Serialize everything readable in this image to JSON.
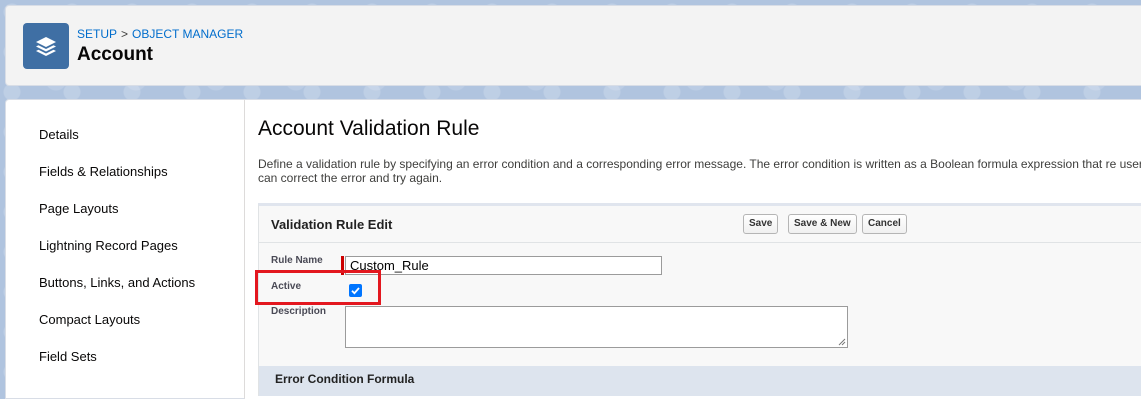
{
  "header": {
    "breadcrumb": {
      "setup": "SETUP",
      "separator": ">",
      "object_manager": "OBJECT MANAGER"
    },
    "title": "Account",
    "icon": "layers-icon"
  },
  "sidebar": {
    "items": [
      {
        "label": "Details"
      },
      {
        "label": "Fields & Relationships"
      },
      {
        "label": "Page Layouts"
      },
      {
        "label": "Lightning Record Pages"
      },
      {
        "label": "Buttons, Links, and Actions"
      },
      {
        "label": "Compact Layouts"
      },
      {
        "label": "Field Sets"
      }
    ]
  },
  "main": {
    "title": "Account Validation Rule",
    "description": "Define a validation rule by specifying an error condition and a corresponding error message. The error condition is written as a Boolean formula expression that re user can correct the error and try again."
  },
  "form": {
    "section_title": "Validation Rule Edit",
    "buttons": {
      "save": "Save",
      "save_new": "Save & New",
      "cancel": "Cancel"
    },
    "rule_name_label": "Rule Name",
    "rule_name_value": "Custom_Rule",
    "active_label": "Active",
    "active_checked": true,
    "description_label": "Description",
    "description_value": "",
    "error_section_title": "Error Condition Formula"
  },
  "colors": {
    "accent": "#006dcc",
    "object_icon_bg": "#3f6fa4",
    "highlight": "#e3171f",
    "required": "#cc0000"
  }
}
